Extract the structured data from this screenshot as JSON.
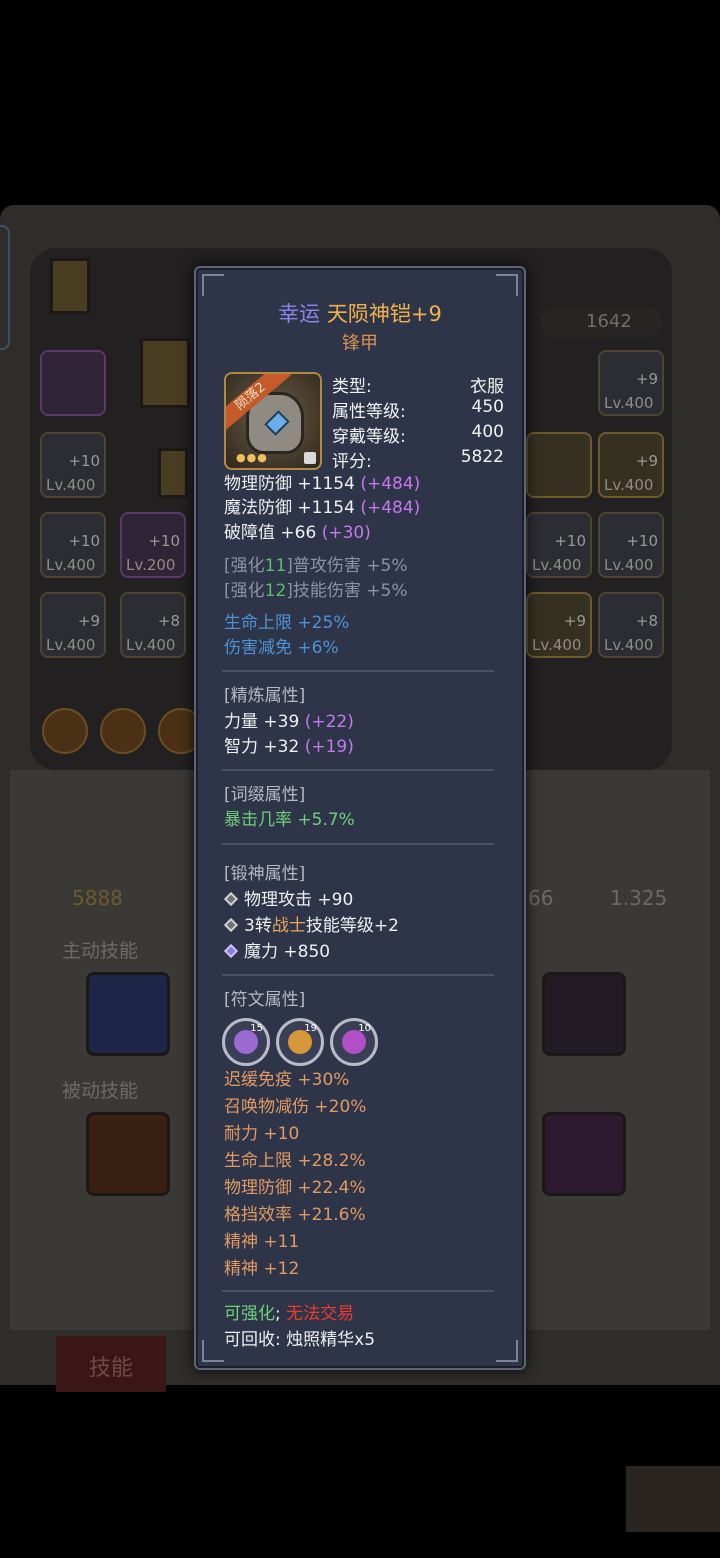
{
  "background": {
    "power_value": "5888",
    "gem_count": "1642",
    "stat_right_a": "66",
    "stat_right_b": "1.325",
    "section_active": "主动技能",
    "section_passive": "被动技能",
    "tab_skill": "技能",
    "slots": [
      {
        "lv": "",
        "plus": ""
      },
      {
        "lv": "Lv.400",
        "plus": "+10"
      },
      {
        "lv": "Lv.400",
        "plus": "+10"
      },
      {
        "lv": "Lv.200",
        "plus": "+10"
      },
      {
        "lv": "Lv.400",
        "plus": "+9"
      },
      {
        "lv": "Lv.400",
        "plus": "+8"
      },
      {
        "lv": "Lv.400",
        "plus": "+9"
      },
      {
        "lv": "Lv.400",
        "plus": "+9"
      },
      {
        "lv": "Lv.400",
        "plus": "+10"
      },
      {
        "lv": "Lv.400",
        "plus": "+10"
      },
      {
        "lv": "Lv.400",
        "plus": "+9"
      },
      {
        "lv": "Lv.400",
        "plus": "+8"
      },
      {
        "lv": "",
        "plus": ""
      }
    ]
  },
  "tooltip": {
    "title_prefix": "幸运",
    "title_name": "天陨神铠+9",
    "subtitle": "锋甲",
    "item_badge": "陨落2",
    "info": [
      {
        "label": "类型:",
        "value": "衣服"
      },
      {
        "label": "属性等级:",
        "value": "450"
      },
      {
        "label": "穿戴等级:",
        "value": "400"
      },
      {
        "label": "评分:",
        "value": "5822"
      }
    ],
    "base_stats": [
      {
        "text": "物理防御 +1154",
        "bonus": "(+484)"
      },
      {
        "text": "魔法防御 +1154",
        "bonus": "(+484)"
      },
      {
        "text": "破障值 +66",
        "bonus": "(+30)"
      }
    ],
    "enhance": [
      {
        "pre": "[强化",
        "num": "11",
        "post": "]普攻伤害 +5%"
      },
      {
        "pre": "[强化",
        "num": "12",
        "post": "]技能伤害 +5%"
      }
    ],
    "set_bonus": [
      "生命上限 +25%",
      "伤害减免 +6%"
    ],
    "refine": {
      "header": "[精炼属性]",
      "lines": [
        {
          "text": "力量 +39",
          "bonus": "(+22)"
        },
        {
          "text": "智力 +32",
          "bonus": "(+19)"
        }
      ]
    },
    "affix": {
      "header": "[词缀属性]",
      "line": "暴击几率 +5.7%"
    },
    "godforge": {
      "header": "[锻神属性]",
      "line1": "物理攻击 +90",
      "line2_pre": "3转",
      "line2_job": "战士",
      "line2_post": "技能等级+2",
      "line3": "魔力 +850"
    },
    "rune": {
      "header": "[符文属性]",
      "levels": [
        "15",
        "19",
        "10"
      ],
      "lines": [
        "迟缓免疫 +30%",
        "召唤物减伤 +20%",
        "耐力 +10",
        "生命上限 +28.2%",
        "物理防御 +22.4%",
        "格挡效率 +21.6%",
        "精神 +11",
        "精神 +12"
      ]
    },
    "footer": {
      "can_enhance": "可强化",
      "semicolon": ";",
      "no_trade": "无法交易",
      "recycle_label": "可回收:",
      "recycle_value": "烛照精华x5"
    }
  }
}
